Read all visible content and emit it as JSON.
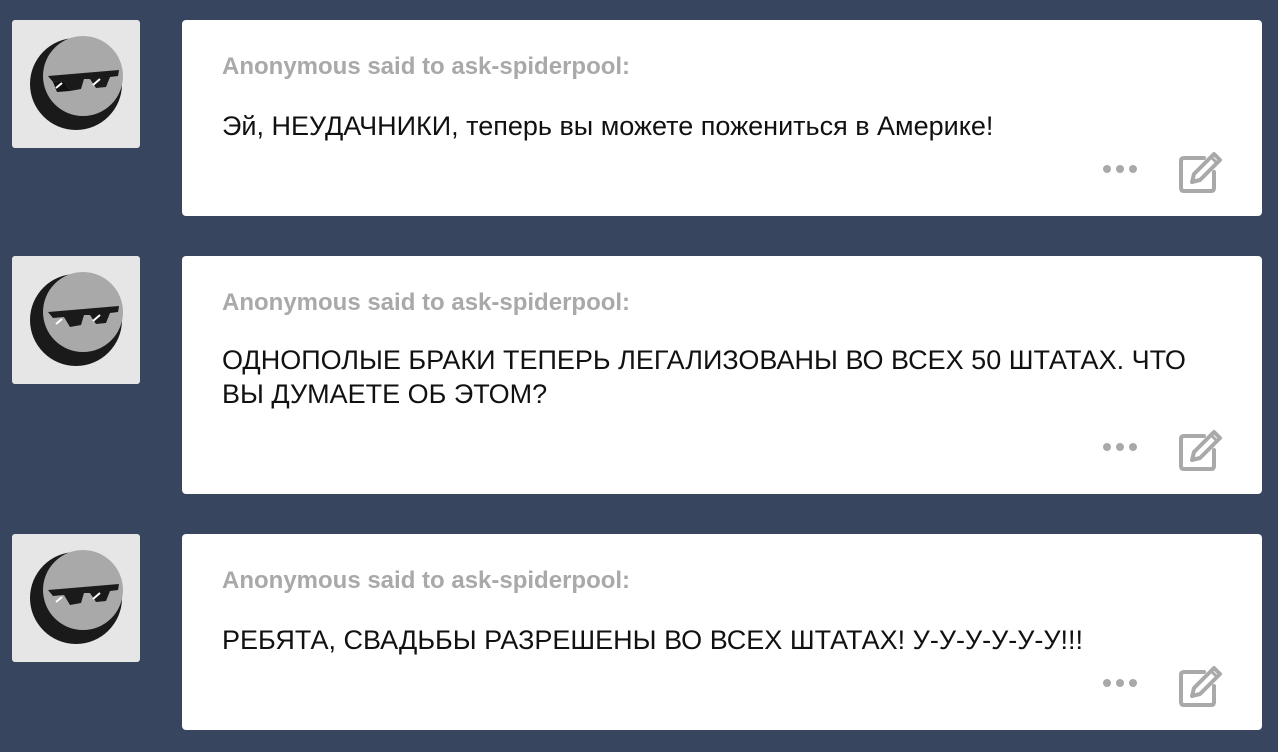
{
  "posts": [
    {
      "asker": "Anonymous said to ask-spiderpool:",
      "question": "Эй, НЕУДАЧНИКИ, теперь вы можете пожениться в Америке!"
    },
    {
      "asker": "Anonymous said to ask-spiderpool:",
      "question": "ОДНОПОЛЫЕ БРАКИ ТЕПЕРЬ ЛЕГАЛИЗОВАНЫ ВО ВСЕХ 50 ШТАТАХ. ЧТО ВЫ ДУМАЕТЕ ОБ ЭТОМ?"
    },
    {
      "asker": "Anonymous said to ask-spiderpool:",
      "question": "РЕБЯТА, СВАДЬБЫ РАЗРЕШЕНЫ ВО ВСЕХ ШТАТАХ! У-У-У-У-У-У!!!"
    }
  ],
  "icons": {
    "avatar": "anonymous-sunglasses-avatar",
    "more": "more-options-icon",
    "edit": "edit-pencil-icon"
  },
  "colors": {
    "background": "#37465e",
    "card": "#ffffff",
    "asker_text": "#a9a9a9",
    "question_text": "#111111",
    "icon": "#a9a9a9",
    "avatar_bg": "#e6e6e6"
  }
}
